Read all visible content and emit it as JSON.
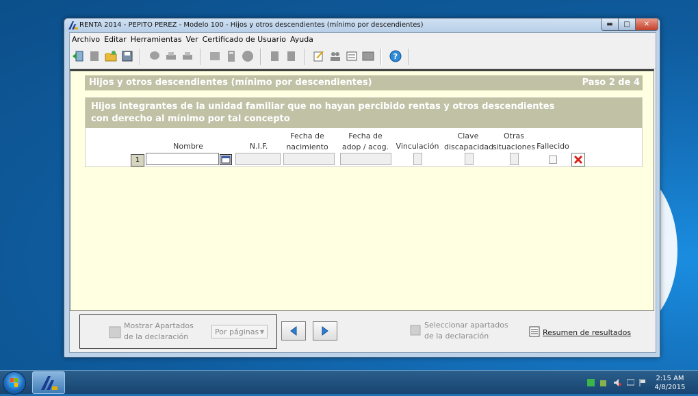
{
  "window": {
    "title": "RENTA 2014 - PEPITO PEREZ - Modelo 100 - Hijos y otros descendientes (mínimo por descendientes)",
    "minimize": "▬",
    "maximize": "□",
    "close": "✕"
  },
  "menu": [
    "Archivo",
    "Editar",
    "Herramientas",
    "Ver",
    "Certificado de Usuario",
    "Ayuda"
  ],
  "section": {
    "title": "Hijos y otros descendientes (mínimo por descendientes)",
    "step": "Paso 2 de 4"
  },
  "panel": {
    "heading_line1": "Hijos integrantes de la unidad familiar que no hayan percibido rentas y otros descendientes",
    "heading_line2": "con derecho al mínimo por tal concepto",
    "columns": {
      "nombre": "Nombre",
      "nif": "N.I.F.",
      "fecha_nac_1": "Fecha de",
      "fecha_nac_2": "nacimiento",
      "fecha_adop_1": "Fecha de",
      "fecha_adop_2": "adop / acog.",
      "vinculacion": "Vinculación",
      "clave_1": "Clave",
      "clave_2": "discapacidad",
      "otras_1": "Otras",
      "otras_2": "situaciones",
      "fallecido": "Fallecido"
    },
    "rows": [
      {
        "index": "1",
        "nombre": "",
        "nif": "",
        "fecha_nacimiento": "",
        "fecha_adopcion": ""
      }
    ]
  },
  "footer": {
    "mostrar_1": "Mostrar Apartados",
    "mostrar_2": "de la declaración",
    "select_value": "Por páginas",
    "seleccionar_1": "Seleccionar apartados",
    "seleccionar_2": "de la declaración",
    "resumen": "Resumen de resultados"
  },
  "taskbar": {
    "time": "2:15 AM",
    "date": "4/8/2015"
  },
  "colors": {
    "accent_bar": "#c1c1a6",
    "content_bg": "#ffffe1",
    "close_red": "#c4402a"
  }
}
